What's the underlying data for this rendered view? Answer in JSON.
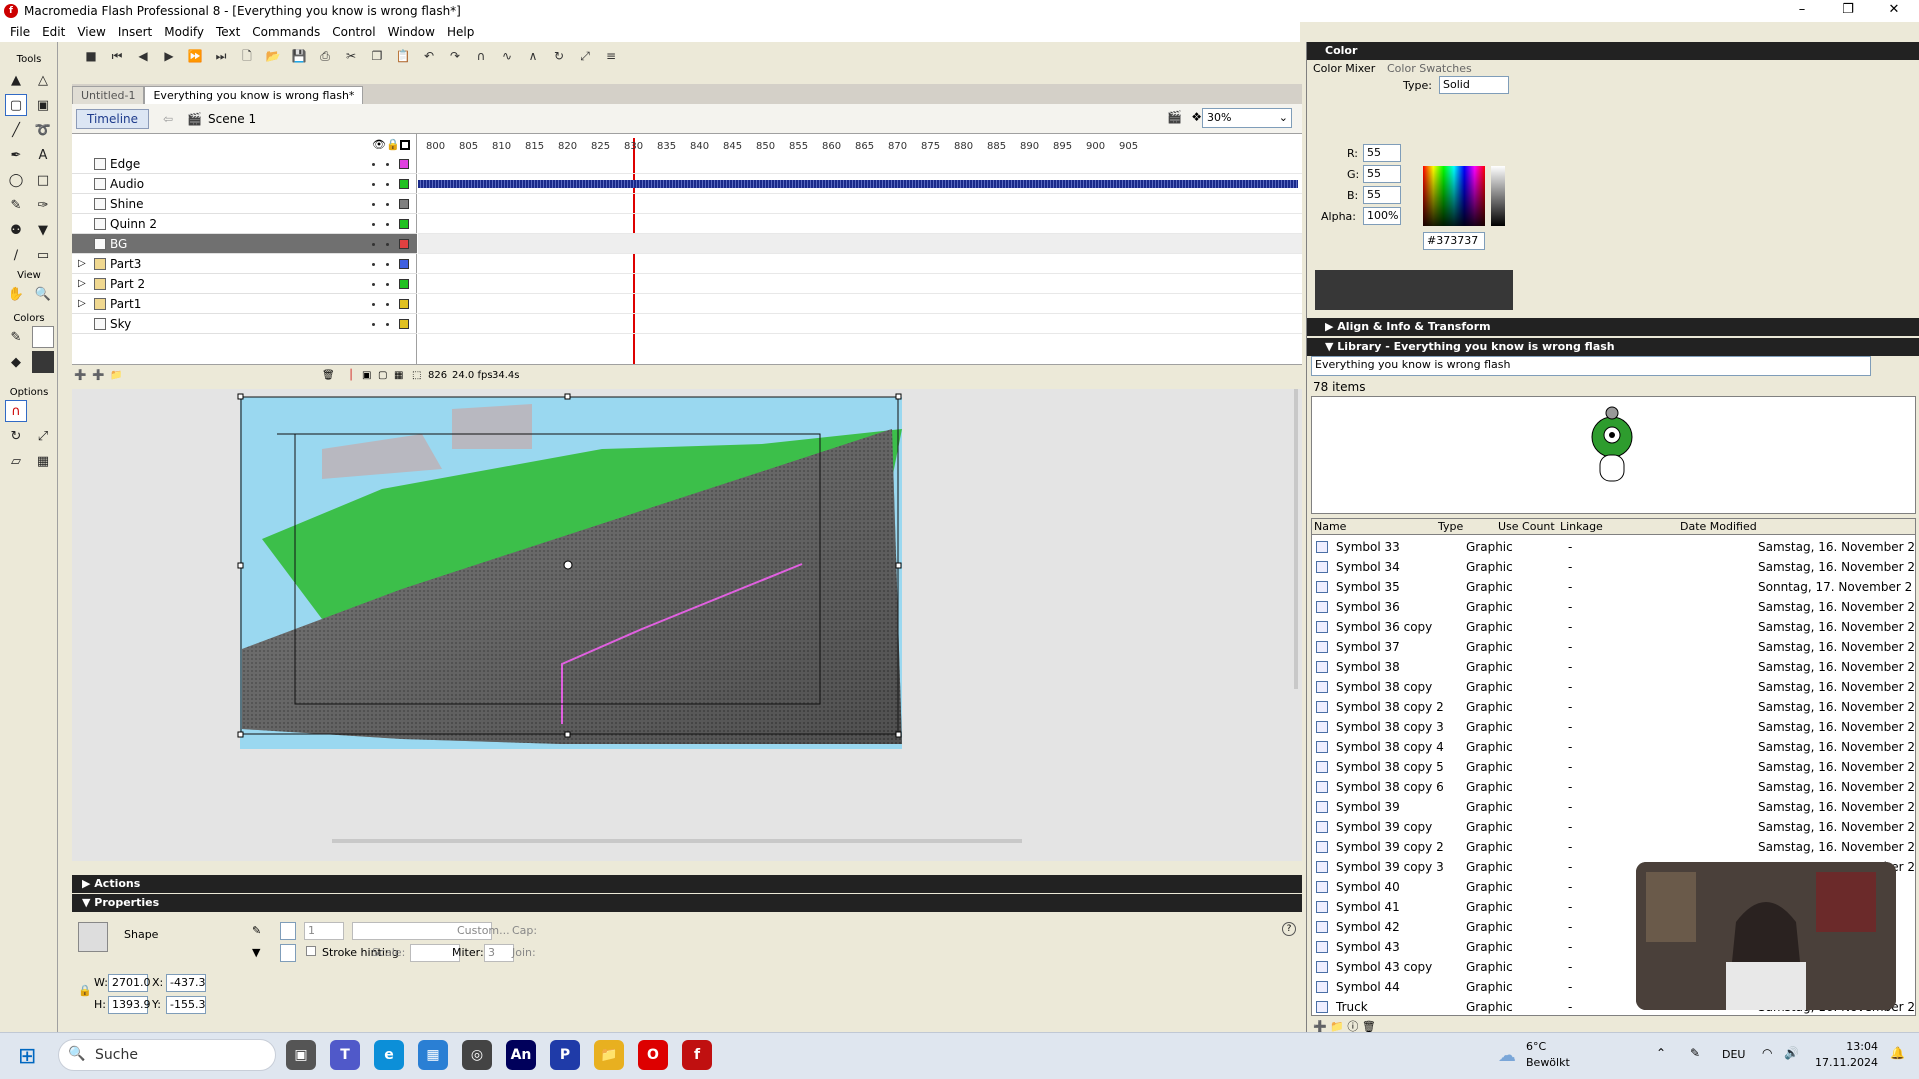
{
  "window": {
    "title": "Macromedia Flash Professional 8 - [Everything you know is wrong flash*]",
    "minimize": "–",
    "maximize": "❐",
    "close": "✕"
  },
  "menu": [
    "File",
    "Edit",
    "View",
    "Insert",
    "Modify",
    "Text",
    "Commands",
    "Control",
    "Window",
    "Help"
  ],
  "tools": {
    "title": "Tools",
    "view_label": "View",
    "colors_label": "Colors",
    "options_label": "Options"
  },
  "doc_tabs": [
    "Untitled-1",
    "Everything you know is wrong flash*"
  ],
  "editbar": {
    "timeline_button": "Timeline",
    "scene": "Scene 1",
    "zoom": "30%"
  },
  "timeline": {
    "frame_numbers": [
      "800",
      "805",
      "810",
      "815",
      "820",
      "825",
      "830",
      "835",
      "840",
      "845",
      "850",
      "855",
      "860",
      "865",
      "870",
      "875",
      "880",
      "885",
      "890",
      "895",
      "900",
      "905"
    ],
    "layers": [
      {
        "name": "Edge",
        "color": "#e040e0",
        "locked": true
      },
      {
        "name": "Audio",
        "color": "#20c020",
        "locked": false
      },
      {
        "name": "Shine",
        "color": "#808080",
        "locked": true
      },
      {
        "name": "Quinn 2",
        "color": "#20c020",
        "locked": true
      },
      {
        "name": "BG",
        "color": "#e04040",
        "locked": false,
        "selected": true
      },
      {
        "name": "Part3",
        "color": "#4060e0",
        "folder": true
      },
      {
        "name": "Part 2",
        "color": "#20c020",
        "folder": true
      },
      {
        "name": "Part1",
        "color": "#e0c020",
        "folder": true
      },
      {
        "name": "Sky",
        "color": "#e0c020",
        "locked": false
      }
    ],
    "current_frame": "826",
    "fps": "24.0 fps",
    "time": "34.4s"
  },
  "actions_panel": {
    "title": "Actions"
  },
  "properties": {
    "title": "Properties",
    "type": "Shape",
    "stroke_size": "1",
    "custom_btn": "Custom...",
    "cap_label": "Cap:",
    "stroke_hinting": "Stroke hinting",
    "scale_label": "Scale:",
    "miter_label": "Miter:",
    "miter": "3",
    "join_label": "Join:",
    "w_label": "W:",
    "w": "2701.0",
    "h_label": "H:",
    "h": "1393.9",
    "x_label": "X:",
    "x": "-437.3",
    "y_label": "Y:",
    "y": "-155.3"
  },
  "color_panel": {
    "title": "Color",
    "tabs": [
      "Color Mixer",
      "Color Swatches"
    ],
    "type_label": "Type:",
    "type": "Solid",
    "r_label": "R:",
    "r": "55",
    "g_label": "G:",
    "g": "55",
    "b_label": "B:",
    "b": "55",
    "alpha_label": "Alpha:",
    "alpha": "100%",
    "hex": "#373737"
  },
  "align_panel": {
    "title": "Align & Info & Transform"
  },
  "library": {
    "title": "Library - Everything you know is wrong flash",
    "doc": "Everything you know is wrong flash",
    "count": "78 items",
    "columns": [
      "Name",
      "Type",
      "Use Count",
      "Linkage",
      "Date Modified"
    ],
    "items": [
      {
        "name": "Symbol 33",
        "type": "Graphic",
        "use": "-",
        "date": "Samstag, 16. November 2"
      },
      {
        "name": "Symbol 34",
        "type": "Graphic",
        "use": "-",
        "date": "Samstag, 16. November 2"
      },
      {
        "name": "Symbol 35",
        "type": "Graphic",
        "use": "-",
        "date": "Sonntag, 17. November 2"
      },
      {
        "name": "Symbol 36",
        "type": "Graphic",
        "use": "-",
        "date": "Samstag, 16. November 2"
      },
      {
        "name": "Symbol 36 copy",
        "type": "Graphic",
        "use": "-",
        "date": "Samstag, 16. November 2"
      },
      {
        "name": "Symbol 37",
        "type": "Graphic",
        "use": "-",
        "date": "Samstag, 16. November 2"
      },
      {
        "name": "Symbol 38",
        "type": "Graphic",
        "use": "-",
        "date": "Samstag, 16. November 2"
      },
      {
        "name": "Symbol 38 copy",
        "type": "Graphic",
        "use": "-",
        "date": "Samstag, 16. November 2"
      },
      {
        "name": "Symbol 38 copy 2",
        "type": "Graphic",
        "use": "-",
        "date": "Samstag, 16. November 2"
      },
      {
        "name": "Symbol 38 copy 3",
        "type": "Graphic",
        "use": "-",
        "date": "Samstag, 16. November 2"
      },
      {
        "name": "Symbol 38 copy 4",
        "type": "Graphic",
        "use": "-",
        "date": "Samstag, 16. November 2"
      },
      {
        "name": "Symbol 38 copy 5",
        "type": "Graphic",
        "use": "-",
        "date": "Samstag, 16. November 2"
      },
      {
        "name": "Symbol 38 copy 6",
        "type": "Graphic",
        "use": "-",
        "date": "Samstag, 16. November 2"
      },
      {
        "name": "Symbol 39",
        "type": "Graphic",
        "use": "-",
        "date": "Samstag, 16. November 2"
      },
      {
        "name": "Symbol 39 copy",
        "type": "Graphic",
        "use": "-",
        "date": "Samstag, 16. November 2"
      },
      {
        "name": "Symbol 39 copy 2",
        "type": "Graphic",
        "use": "-",
        "date": "Samstag, 16. November 2"
      },
      {
        "name": "Symbol 39 copy 3",
        "type": "Graphic",
        "use": "-",
        "date": "Samstag, 16. November 2"
      },
      {
        "name": "Symbol 40",
        "type": "Graphic",
        "use": "-",
        "date": ""
      },
      {
        "name": "Symbol 41",
        "type": "Graphic",
        "use": "-",
        "date": ""
      },
      {
        "name": "Symbol 42",
        "type": "Graphic",
        "use": "-",
        "date": ""
      },
      {
        "name": "Symbol 43",
        "type": "Graphic",
        "use": "-",
        "date": ""
      },
      {
        "name": "Symbol 43 copy",
        "type": "Graphic",
        "use": "-",
        "date": ""
      },
      {
        "name": "Symbol 44",
        "type": "Graphic",
        "use": "-",
        "date": ""
      },
      {
        "name": "Truck",
        "type": "Graphic",
        "use": "-",
        "date": "Samstag, 16. November 2"
      }
    ]
  },
  "taskbar": {
    "search": "Suche",
    "weather_temp": "6°C",
    "weather_desc": "Bewölkt",
    "lang": "DEU",
    "time": "13:04",
    "date": "17.11.2024"
  }
}
